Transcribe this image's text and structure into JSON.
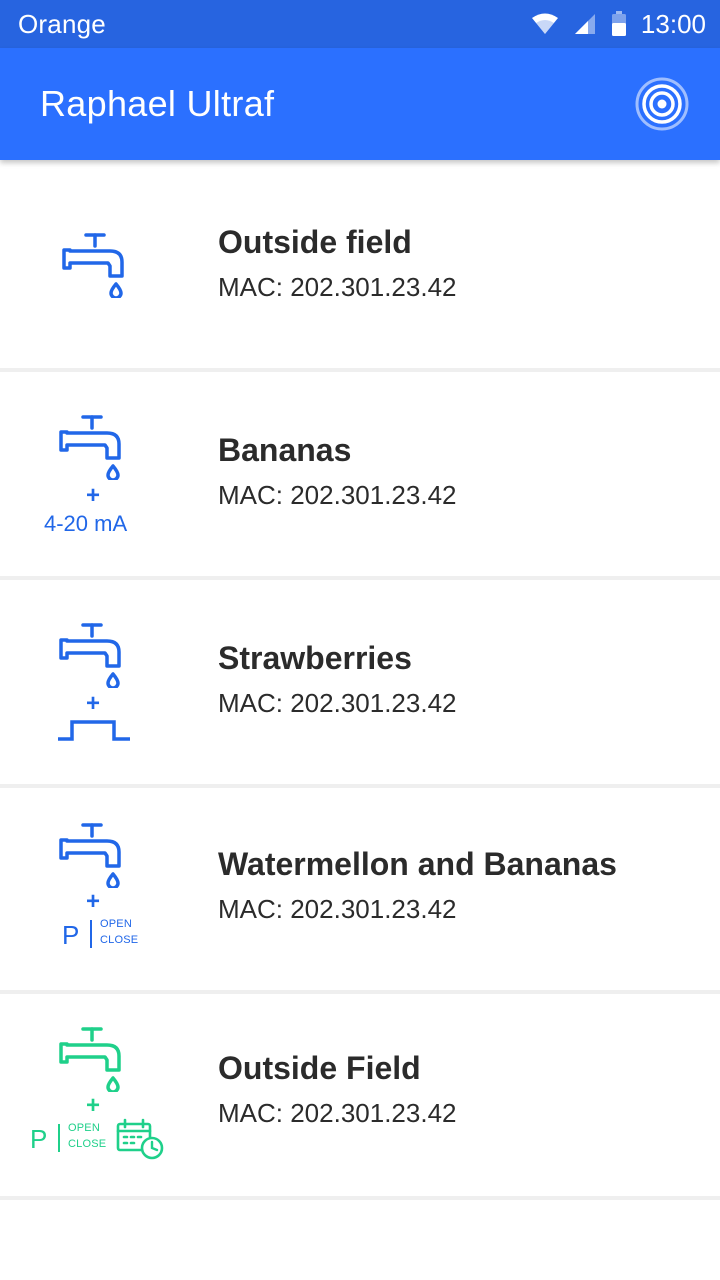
{
  "status_bar": {
    "carrier": "Orange",
    "time": "13:00",
    "icons": [
      "wifi-icon",
      "cellular-signal-icon",
      "battery-icon"
    ]
  },
  "app_bar": {
    "title": "Raphael Ultraf",
    "action_icon": "scan-target-icon"
  },
  "colors": {
    "status_bar": "#2764e0",
    "app_bar": "#2b70ff",
    "icon_blue": "#2167e8",
    "icon_green": "#1fd08a",
    "text_dark": "#2b2b2b",
    "divider": "#efefef"
  },
  "devices": [
    {
      "name": "Outside field",
      "mac": "MAC: 202.301.23.42",
      "icon": "water-tap-icon"
    },
    {
      "name": "Bananas",
      "mac": "MAC: 202.301.23.42",
      "icon": "water-tap-icon",
      "plus": "+",
      "sensor_label": "4-20 mA"
    },
    {
      "name": "Strawberries",
      "mac": "MAC: 202.301.23.42",
      "icon": "water-tap-icon",
      "plus": "+",
      "extra_icon": "pulse-signal-icon"
    },
    {
      "name": "Watermellon and Bananas",
      "mac": "MAC: 202.301.23.42",
      "icon": "water-tap-icon",
      "plus": "+",
      "p_letter": "P",
      "open_label": "OPEN",
      "close_label": "CLOSE"
    },
    {
      "name": "Outside Field",
      "mac": "MAC: 202.301.23.42",
      "icon": "water-tap-icon",
      "plus": "+",
      "p_letter": "P",
      "open_label": "OPEN",
      "close_label": "CLOSE",
      "extra_icon": "calendar-clock-icon"
    }
  ]
}
